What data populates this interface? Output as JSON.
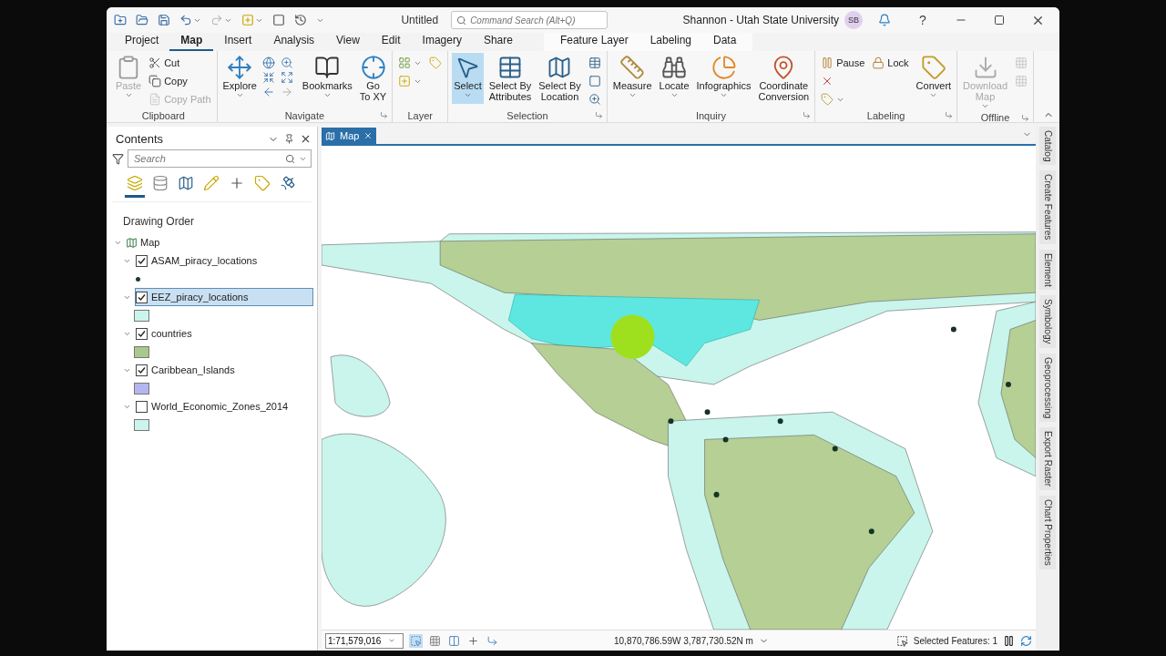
{
  "window": {
    "title": "Untitled",
    "user": "Shannon - Utah State University",
    "avatar": "SB",
    "help": "?"
  },
  "command_search": {
    "placeholder": "Command Search (Alt+Q)"
  },
  "ribbon_tabs": [
    {
      "label": "Project",
      "selected": false
    },
    {
      "label": "Map",
      "selected": true
    },
    {
      "label": "Insert",
      "selected": false
    },
    {
      "label": "Analysis",
      "selected": false
    },
    {
      "label": "View",
      "selected": false
    },
    {
      "label": "Edit",
      "selected": false
    },
    {
      "label": "Imagery",
      "selected": false
    },
    {
      "label": "Share",
      "selected": false
    }
  ],
  "contextual_tabs": [
    {
      "label": "Feature Layer",
      "selected": false
    },
    {
      "label": "Labeling",
      "selected": false
    },
    {
      "label": "Data",
      "selected": false
    }
  ],
  "ribbon_groups": [
    {
      "name": "Clipboard",
      "launcher": false,
      "columns": [
        {
          "kind": "large",
          "lines": [
            "Paste"
          ],
          "menu": true,
          "disabled": true,
          "selected": false
        },
        {
          "kind": "stack",
          "items": [
            {
              "label": "Cut",
              "disabled": false
            },
            {
              "label": "Copy",
              "disabled": false
            },
            {
              "label": "Copy Path",
              "disabled": true
            }
          ]
        }
      ]
    },
    {
      "name": "Navigate",
      "launcher": true,
      "columns": [
        {
          "kind": "large",
          "lines": [
            "Explore"
          ],
          "menu": true,
          "disabled": false,
          "selected": false
        },
        {
          "kind": "grid"
        },
        {
          "kind": "large",
          "lines": [
            "Bookmarks"
          ],
          "menu": true,
          "disabled": false,
          "selected": false
        },
        {
          "kind": "large",
          "lines": [
            "Go",
            "To XY"
          ],
          "menu": false,
          "disabled": false,
          "selected": false
        }
      ]
    },
    {
      "name": "Layer",
      "launcher": false,
      "columns": [
        {
          "kind": "stack",
          "items": [
            {
              "disabled": false,
              "menu": true
            },
            {
              "disabled": false,
              "menu": true
            }
          ]
        },
        {
          "kind": "stack",
          "items": [
            {
              "disabled": false
            }
          ]
        }
      ]
    },
    {
      "name": "Selection",
      "launcher": true,
      "columns": [
        {
          "kind": "large",
          "lines": [
            "Select"
          ],
          "menu": true,
          "disabled": false,
          "selected": true
        },
        {
          "kind": "large",
          "lines": [
            "Select By",
            "Attributes"
          ],
          "menu": false,
          "disabled": false,
          "selected": false
        },
        {
          "kind": "large",
          "lines": [
            "Select By",
            "Location"
          ],
          "menu": false,
          "disabled": false,
          "selected": false
        },
        {
          "kind": "stack",
          "items": [
            {
              "disabled": false
            },
            {
              "disabled": false
            },
            {
              "disabled": false
            }
          ]
        }
      ]
    },
    {
      "name": "Inquiry",
      "launcher": true,
      "columns": [
        {
          "kind": "large",
          "lines": [
            "Measure"
          ],
          "menu": true,
          "disabled": false,
          "selected": false
        },
        {
          "kind": "large",
          "lines": [
            "Locate"
          ],
          "menu": true,
          "disabled": false,
          "selected": false
        },
        {
          "kind": "large",
          "lines": [
            "Infographics"
          ],
          "menu": true,
          "disabled": false,
          "selected": false
        },
        {
          "kind": "large",
          "lines": [
            "Coordinate",
            "Conversion"
          ],
          "menu": false,
          "disabled": false,
          "selected": false
        }
      ]
    },
    {
      "name": "Labeling",
      "launcher": true,
      "columns": [
        {
          "kind": "stack",
          "items": [
            {
              "label": "Pause",
              "disabled": false
            },
            {
              "disabled": false
            },
            {
              "disabled": false,
              "menu": true
            }
          ]
        },
        {
          "kind": "stack",
          "items": [
            {
              "label": "Lock",
              "disabled": false
            }
          ]
        },
        {
          "kind": "large",
          "lines": [
            "Convert"
          ],
          "menu": true,
          "disabled": false,
          "selected": false
        }
      ]
    },
    {
      "name": "Offline",
      "launcher": true,
      "columns": [
        {
          "kind": "large",
          "lines": [
            "Download",
            "Map"
          ],
          "menu": true,
          "disabled": true,
          "selected": false
        },
        {
          "kind": "stack",
          "items": [
            {
              "disabled": true
            },
            {
              "disabled": true
            }
          ]
        }
      ]
    }
  ],
  "contents": {
    "title": "Contents",
    "search": {
      "placeholder": "Search"
    },
    "view_tabs": [
      {
        "selected": true
      },
      {
        "selected": false
      },
      {
        "selected": false
      },
      {
        "selected": false
      },
      {
        "selected": false
      },
      {
        "selected": false
      },
      {
        "selected": false
      }
    ],
    "heading": "Drawing Order",
    "tree": {
      "label": "Map",
      "expanded": true,
      "children": [
        {
          "label": "ASAM_piracy_locations",
          "checked": true,
          "selected": false,
          "expanded": true,
          "kind": "point",
          "color": "#1c3a2c"
        },
        {
          "label": "EEZ_piracy_locations",
          "checked": true,
          "selected": true,
          "expanded": true,
          "kind": "fill",
          "color": "#cbf5ec"
        },
        {
          "label": "countries",
          "checked": true,
          "selected": false,
          "expanded": true,
          "kind": "fill",
          "color": "#a9c98c"
        },
        {
          "label": "Caribbean_Islands",
          "checked": true,
          "selected": false,
          "expanded": true,
          "kind": "fill",
          "color": "#b4b6f0"
        },
        {
          "label": "World_Economic_Zones_2014",
          "checked": false,
          "selected": false,
          "expanded": true,
          "kind": "fill",
          "color": "#cbf5ec"
        }
      ]
    }
  },
  "map_view": {
    "tabs": [
      {
        "label": "Map",
        "selected": true
      }
    ],
    "status": {
      "scale": "1:71,579,016",
      "tools": [
        {
          "selected": true
        },
        {
          "selected": false
        },
        {
          "selected": false
        },
        {
          "selected": false
        },
        {
          "selected": false
        }
      ],
      "coordinates": "10,870,786.59W 3,787,730.52N m",
      "selected_features": "Selected Features: 1"
    }
  },
  "side_tabs": [
    "Catalog",
    "Create Features",
    "Element",
    "Symbology",
    "Geoprocessing",
    "Export Raster",
    "Chart Properties"
  ]
}
